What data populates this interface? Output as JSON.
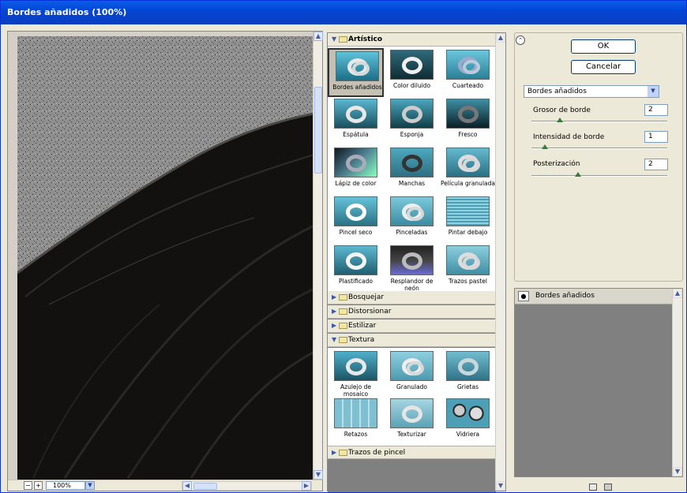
{
  "window": {
    "title": "Bordes añadidos (100%)"
  },
  "preview": {
    "zoom": "100%"
  },
  "categories": {
    "artistico": {
      "label": "Artístico",
      "filters": [
        "Bordes añadidos",
        "Color diluido",
        "Cuarteado",
        "Espátula",
        "Esponja",
        "Fresco",
        "Lápiz de color",
        "Manchas",
        "Película granulada",
        "Pincel seco",
        "Pinceladas",
        "Pintar debajo",
        "Plastificado",
        "Resplandor de neón",
        "Trazos pastel"
      ]
    },
    "bosquejar": {
      "label": "Bosquejar"
    },
    "distorsionar": {
      "label": "Distorsionar"
    },
    "estilizar": {
      "label": "Estilizar"
    },
    "textura": {
      "label": "Textura",
      "filters": [
        "Azulejo de mosaico",
        "Granulado",
        "Grietas",
        "Retazos",
        "Texturizar",
        "Vidriera"
      ]
    },
    "trazos": {
      "label": "Trazos de pincel"
    }
  },
  "buttons": {
    "ok": "OK",
    "cancel": "Cancelar"
  },
  "filter_select": {
    "value": "Bordes añadidos"
  },
  "params": {
    "grosor": {
      "label": "Grosor de borde",
      "value": "2"
    },
    "intensidad": {
      "label": "Intensidad de borde",
      "value": "1"
    },
    "posterizacion": {
      "label": "Posterización",
      "value": "2"
    }
  },
  "layers": {
    "item": "Bordes añadidos"
  },
  "colors": {
    "titlebar": "#0446d5",
    "selected_tile": "#c4c0b3"
  }
}
